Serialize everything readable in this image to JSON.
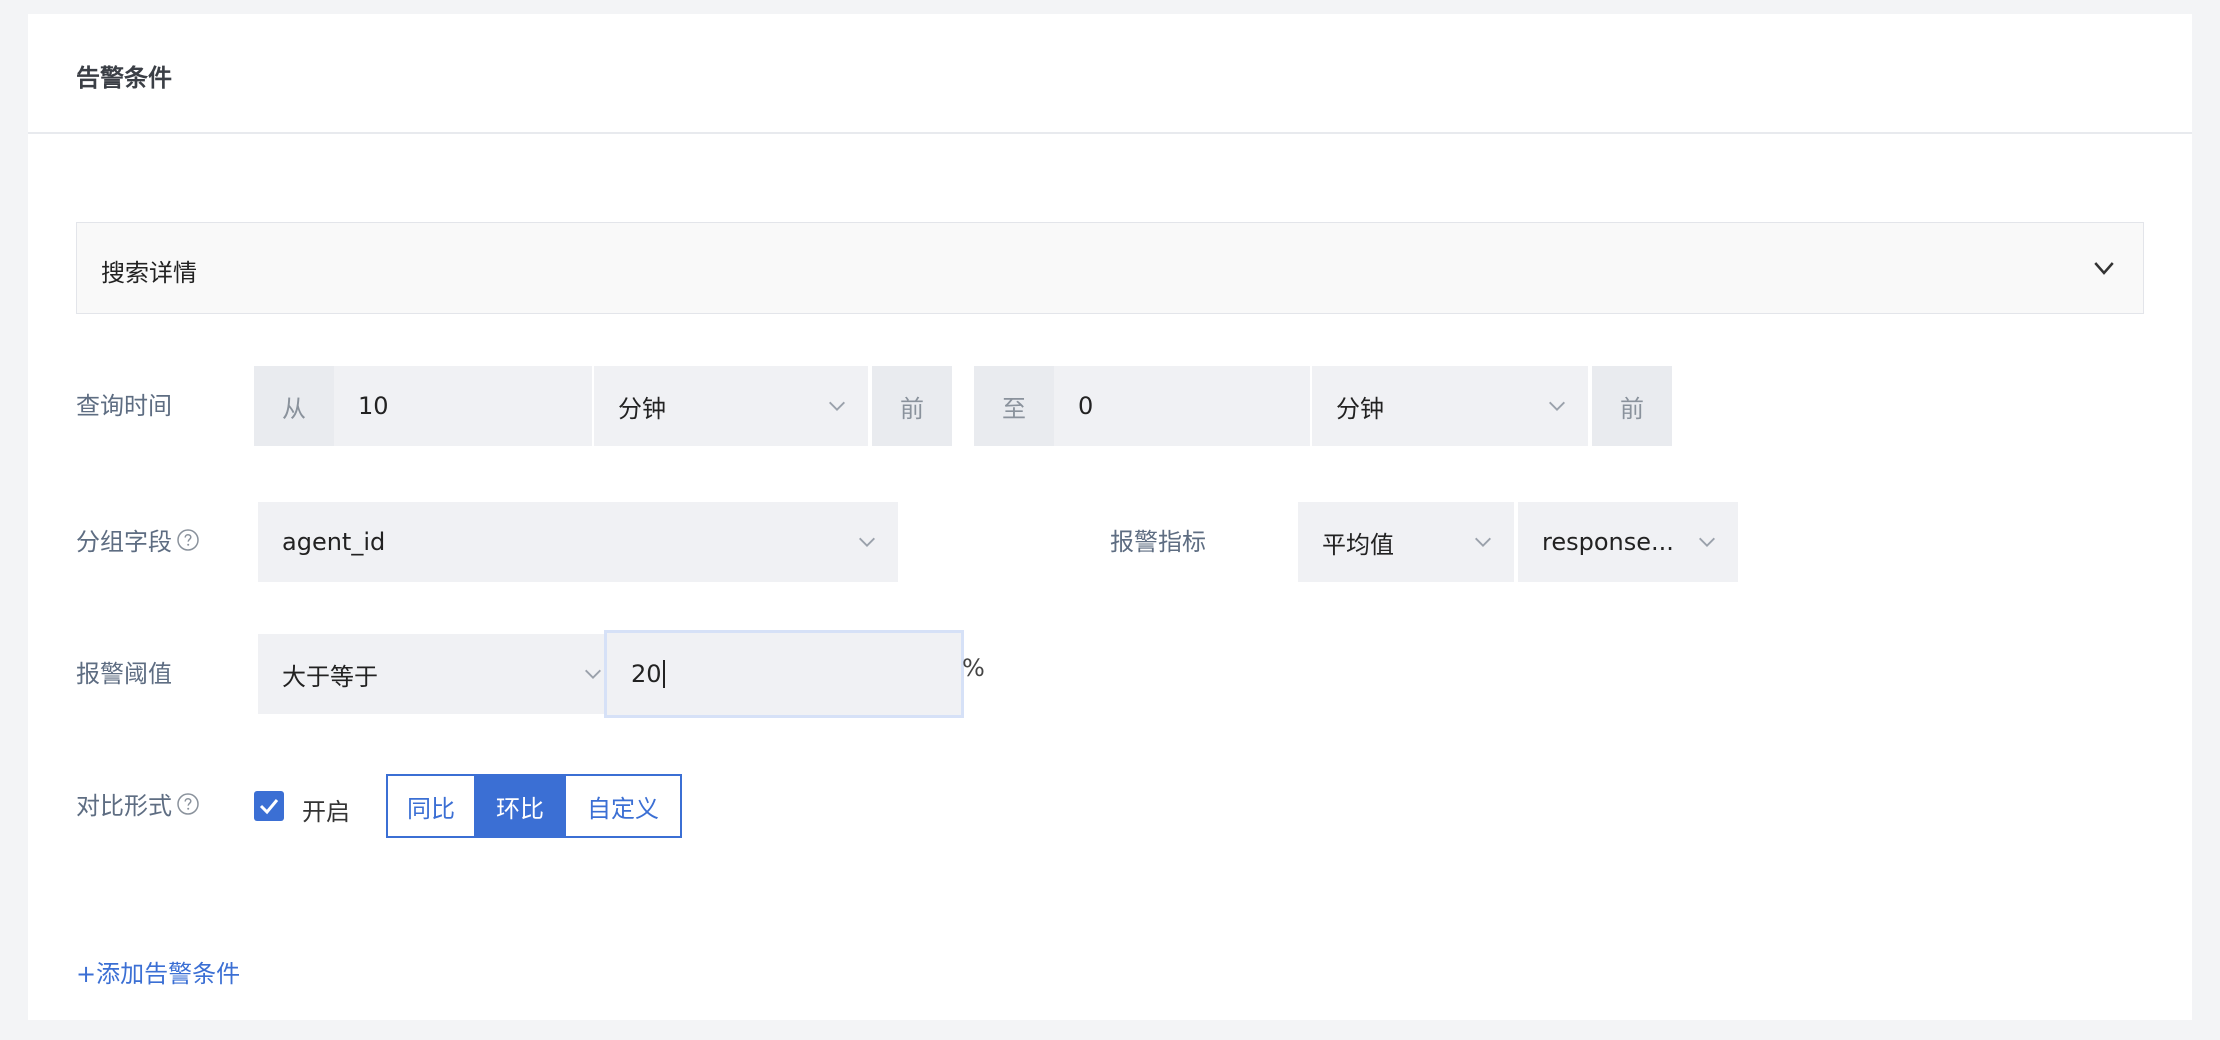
{
  "panel": {
    "title": "告警条件"
  },
  "search_details": {
    "label": "搜索详情",
    "chevron_icon": "chevron-down-icon"
  },
  "query_time": {
    "label": "查询时间",
    "from_prefix": "从",
    "from_value": "10",
    "from_unit": "分钟",
    "from_suffix": "前",
    "to_prefix": "至",
    "to_value": "0",
    "to_unit": "分钟",
    "to_suffix": "前"
  },
  "group_field": {
    "label": "分组字段",
    "value": "agent_id",
    "help_icon": "question-circle-icon"
  },
  "alarm_metric": {
    "label": "报警指标",
    "aggregation": "平均值",
    "field": "response..."
  },
  "threshold": {
    "label": "报警阈值",
    "operator": "大于等于",
    "value": "20",
    "unit": "%"
  },
  "comparison": {
    "label": "对比形式",
    "help_icon": "question-circle-icon",
    "enabled_label": "开启",
    "enabled": true,
    "options": [
      "同比",
      "环比",
      "自定义"
    ],
    "selected": "环比"
  },
  "add_condition": {
    "label": "+添加告警条件"
  },
  "colors": {
    "accent": "#3b6fd4",
    "label_text": "#5e6d82",
    "field_bg": "#f0f1f4",
    "addon_bg": "#e9ebef"
  }
}
